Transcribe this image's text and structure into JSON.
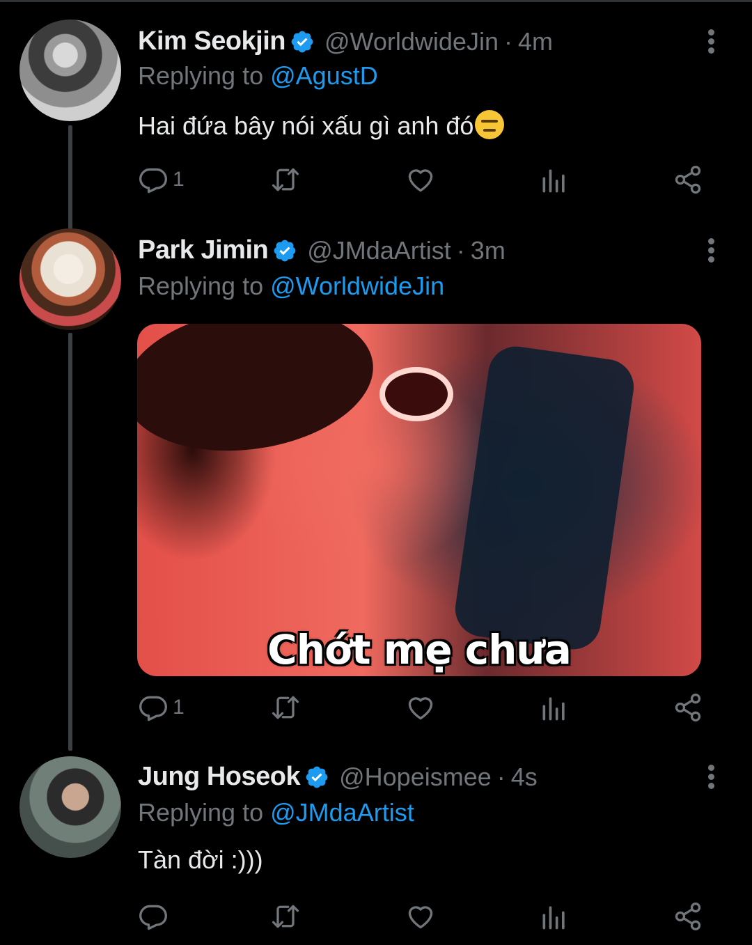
{
  "colors": {
    "background": "#000000",
    "text": "#e7e9ea",
    "muted": "#71767b",
    "accent": "#1d9bf0"
  },
  "reply_prefix": "Replying to",
  "tweets": [
    {
      "name": "Kim Seokjin",
      "handle": "@WorldwideJin",
      "sep": "·",
      "time": "4m",
      "reply_to": "@AgustD",
      "text": "Hai đứa bây nói xấu gì anh đó",
      "emoji": "expressionless-face",
      "reply_count": "1",
      "avatar_icon": "avatar-photo"
    },
    {
      "name": "Park Jimin",
      "handle": "@JMdaArtist",
      "sep": "·",
      "time": "3m",
      "reply_to": "@WorldwideJin",
      "media_caption": "Chớt mẹ chưa",
      "reply_count": "1",
      "avatar_icon": "avatar-photo"
    },
    {
      "name": "Jung Hoseok",
      "handle": "@Hopeismee",
      "sep": "·",
      "time": "4s",
      "reply_to": "@JMdaArtist",
      "text": "Tàn đời :)))",
      "reply_count": "",
      "avatar_icon": "avatar-photo"
    }
  ]
}
